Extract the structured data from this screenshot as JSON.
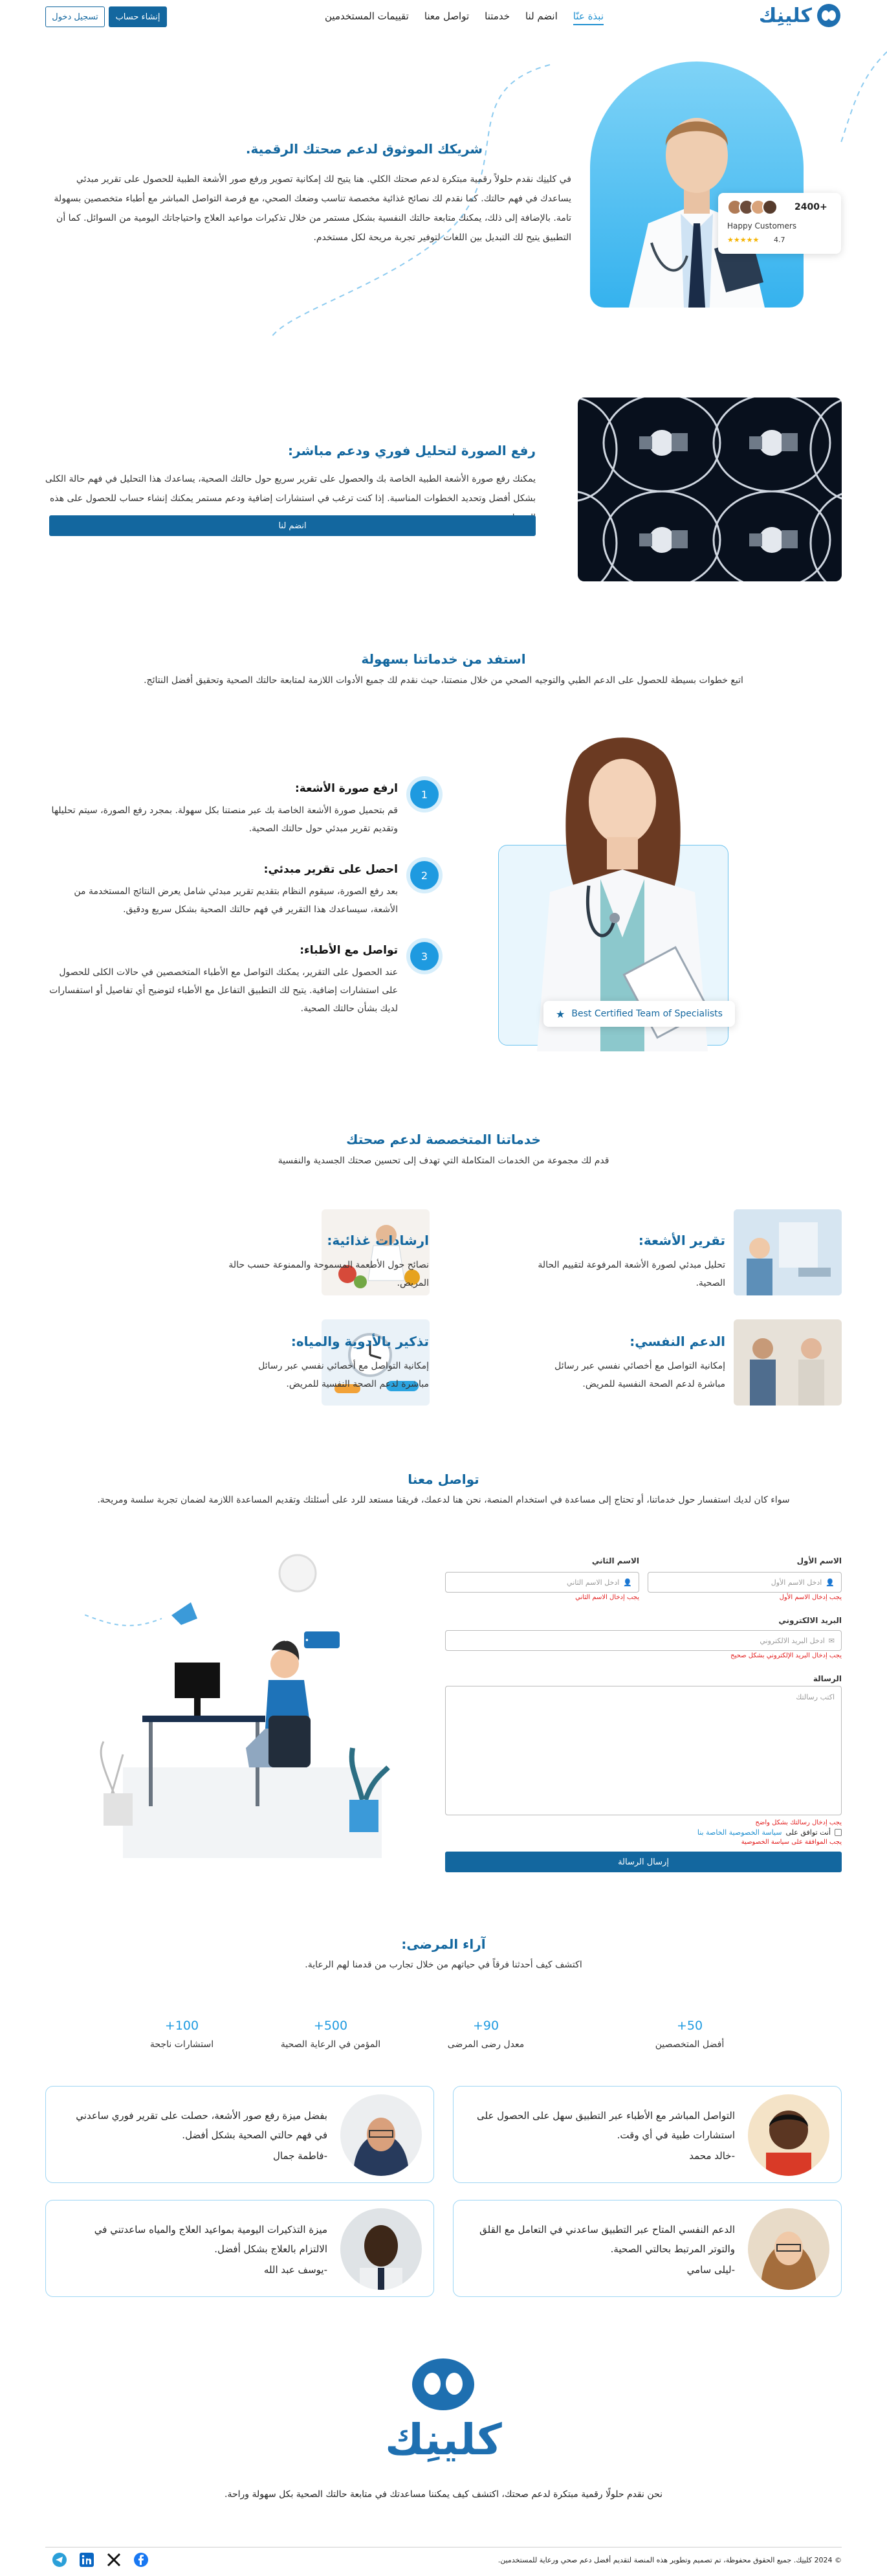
{
  "header": {
    "logo_text": "كلينِك",
    "nav": [
      "نبذة عنّا",
      "انضم لنا",
      "خدمتنا",
      "تواصل معنا",
      "تقييمات المستخدمين"
    ],
    "signup_label": "إنشاء حساب",
    "login_label": "تسجيل دخول"
  },
  "hero": {
    "title": "شريكك الموثوق لدعم صحتك الرقمية.",
    "body": "في كلينِك نقدم حلولاً رقمية مبتكرة لدعم صحتك الكلي. هنا يتيح لك إمكانية تصوير ورفع صور الأشعة الطبية للحصول على تقرير مبدئي يساعدك في فهم حالتك. كما نقدم لك نصائح غذائية مخصصة تناسب وضعك الصحي، مع فرصة التواصل المباشر مع أطباء متخصصين بسهولة تامة. بالإضافة إلى ذلك، يمكنك متابعة حالتك النفسية بشكل مستمر من خلال تذكيرات مواعيد العلاج واحتياجاتك اليومية من السوائل. كما أن التطبيق يتيح لك التبديل بين اللغات لتوفير تجربة مريحة لكل مستخدم.",
    "badge_count": "2400+",
    "badge_label": "Happy Customers",
    "badge_rating": "4.7",
    "badge_stars": "★★★★★"
  },
  "upload": {
    "title": "رفع الصورة لتحليل فوري ودعم مباشر:",
    "body": "يمكنك رفع صورة الأشعة الطبية الخاصة بك والحصول على تقرير سريع حول حالتك الصحية، يساعدك هذا التحليل في فهم حالة الكلى بشكل أفضل وتحديد الخطوات المناسبة. إذا كنت ترغب في استشارات إضافية ودعم مستمر يمكنك إنشاء حساب للحصول على هذه الخدمات.",
    "button": "انضم لنا"
  },
  "steps": {
    "title": "استفد من خدماتنا بسهولة",
    "subtitle": "اتبع خطوات بسيطة للحصول على الدعم الطبي والتوجيه الصحي من خلال منصتنا، حيث نقدم لك جميع الأدوات اللازمة لمتابعة حالتك الصحية وتحقيق أفضل النتائج.",
    "items": [
      {
        "num": "1",
        "title": "ارفع صورة الأشعة:",
        "body": "قم بتحميل صورة الأشعة الخاصة بك عبر منصتنا بكل سهولة. بمجرد رفع الصورة، سيتم تحليلها وتقديم تقرير مبدئي حول حالتك الصحية."
      },
      {
        "num": "2",
        "title": "احصل على تقرير مبدئي:",
        "body": "بعد رفع الصورة، سيقوم النظام بتقديم تقرير مبدئي شامل يعرض النتائج المستخدمة من الأشعة، سيساعدك هذا التقرير في فهم حالتك الصحية بشكل سريع ودقيق."
      },
      {
        "num": "3",
        "title": "تواصل مع الأطباء:",
        "body": "عند الحصول على التقرير، يمكنك التواصل مع الأطباء المتخصصين في حالات الكلى للحصول على استشارات إضافية. يتيح لك التطبيق التفاعل مع الأطباء لتوضيح أي تفاصيل أو استفسارات لديك بشأن حالتك الصحية."
      }
    ],
    "specialist_label": "Best Certified Team of Specialists"
  },
  "services": {
    "title": "خدماتنا المتخصصة لدعم صحتك",
    "subtitle": "قدم لك مجموعة من الخدمات المتكاملة التي تهدف إلى تحسين صحتك الجسدية والنفسية",
    "items": [
      {
        "title": "تقرير الأشعة:",
        "body": "تحليل مبدئي لصورة الأشعة المرفوعة لتقييم الحالة الصحية."
      },
      {
        "title": "ارشادات غذائية:",
        "body": "نصائح حول الأطعمة المسموحة والممنوعة حسب حالة المريض."
      },
      {
        "title": "الدعم النفسي:",
        "body": "إمكانية التواصل مع أخصائي نفسي عبر رسائل مباشرة لدعم الصحة النفسية للمريض."
      },
      {
        "title": "تذكير بالأدوية والمياه:",
        "body": "إمكانية التواصل مع أخصائي نفسي عبر رسائل مباشرة لدعم الصحة النفسية للمريض."
      }
    ]
  },
  "contact": {
    "title": "تواصل معنا",
    "subtitle": "سواء كان لديك استفسار حول خدماتنا، أو تحتاج إلى مساعدة في استخدام المنصة، نحن هنا لدعمك، فريقنا مستعد للرد على أسئلتك وتقديم المساعدة اللازمة لضمان تجربة سلسة ومريحة.",
    "first_name_label": "الاسم الأول",
    "first_name_placeholder": "ادخل الاسم الأول",
    "first_name_error": "يجب إدخال الاسم الأول",
    "last_name_label": "الاسم الثاني",
    "last_name_placeholder": "ادخل الاسم الثاني",
    "last_name_error": "يجب إدخال الاسم الثاني",
    "email_label": "البريد الالكتروني",
    "email_placeholder": "ادخل البريد الالكتروني",
    "email_error": "يجب إدخال البريد الإلكتروني بشكل صحيح",
    "message_label": "الرسالة",
    "message_placeholder": "اكتب رسالتك",
    "message_error": "يجب إدخال رسالتك بشكل واضح",
    "agree_prefix": "أنت توافق على",
    "agree_link": "سياسة الخصوصية الخاصة بنا",
    "agree_error": "يجب الموافقة على سياسة الخصوصية",
    "submit": "إرسال الرسالة",
    "chat_dots": "• • • •"
  },
  "reviews": {
    "title": "آراء المرضى:",
    "subtitle": "اكتشف كيف أحدثنا فرقاً في حياتهم من خلال تجارب من قدمنا لهم الرعاية.",
    "stats": [
      {
        "num": "50+",
        "label": "أفضل المتخصصين"
      },
      {
        "num": "90+",
        "label": "معدل رضى المرضى"
      },
      {
        "num": "500+",
        "label": "المؤمن في الرعاية الصحية"
      },
      {
        "num": "100+",
        "label": "استشارات ناجحة"
      }
    ],
    "items": [
      {
        "quote": "التواصل المباشر مع الأطباء عبر التطبيق سهل على الحصول على استشارات طبية في أي وقت.",
        "name": "-خالد محمد"
      },
      {
        "quote": "بفضل ميزة رفع صور الأشعة، حصلت على تقرير فوري ساعدني في فهم حالتي الصحية بشكل أفضل.",
        "name": "-فاطمة جمال"
      },
      {
        "quote": "الدعم النفسي المتاح عبر التطبيق ساعدني في التعامل مع القلق والتوتر المرتبط بحالتي الصحية.",
        "name": "-ليلى سامي"
      },
      {
        "quote": "ميزة التذكيرات اليومية بمواعيد العلاج والمياه ساعدتني في الالتزام بالعلاج بشكل أفضل.",
        "name": "-يوسف عبد الله"
      }
    ]
  },
  "footer": {
    "logo_text": "كلينِك",
    "tagline": "نحن نقدم حلولًا رقمية مبتكرة لدعم صحتك، اكتشف كيف يمكننا مساعدتك في متابعة حالتك الصحية بكل سهولة وراحة.",
    "copyright": "© 2024 كلينِك. جميع الحقوق محفوظة، تم تصميم وتطوير هذه المنصة لتقديم أفضل دعم صحي ورعاية للمستخدمين."
  },
  "colors": {
    "brand": "#13679f",
    "accent": "#1e9ae0",
    "error": "#e21b1b"
  }
}
